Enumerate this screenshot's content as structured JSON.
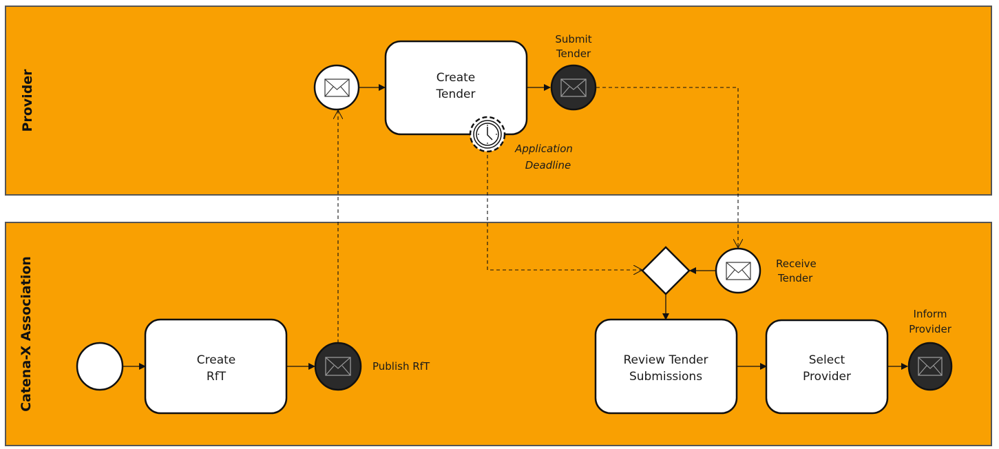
{
  "diagram": {
    "type": "BPMN collaboration",
    "colors": {
      "pool_fill": "#f9a002",
      "task_fill": "#ffffff",
      "throw_event_fill": "#2a2a2a"
    },
    "pools": [
      {
        "id": "provider",
        "label": "Provider"
      },
      {
        "id": "catena",
        "label": "Catena-X Association"
      }
    ],
    "tasks": {
      "create_tender": [
        "Create",
        "Tender"
      ],
      "create_rft": [
        "Create",
        "RfT"
      ],
      "review": [
        "Review Tender",
        "Submissions"
      ],
      "select": [
        "Select",
        "Provider"
      ]
    },
    "events": {
      "submit_tender": [
        "Submit",
        "Tender"
      ],
      "application_deadline": [
        "Application",
        "Deadline"
      ],
      "publish_rft": "Publish RfT",
      "receive_tender": [
        "Receive",
        "Tender"
      ],
      "inform_provider": [
        "Inform",
        "Provider"
      ]
    }
  }
}
